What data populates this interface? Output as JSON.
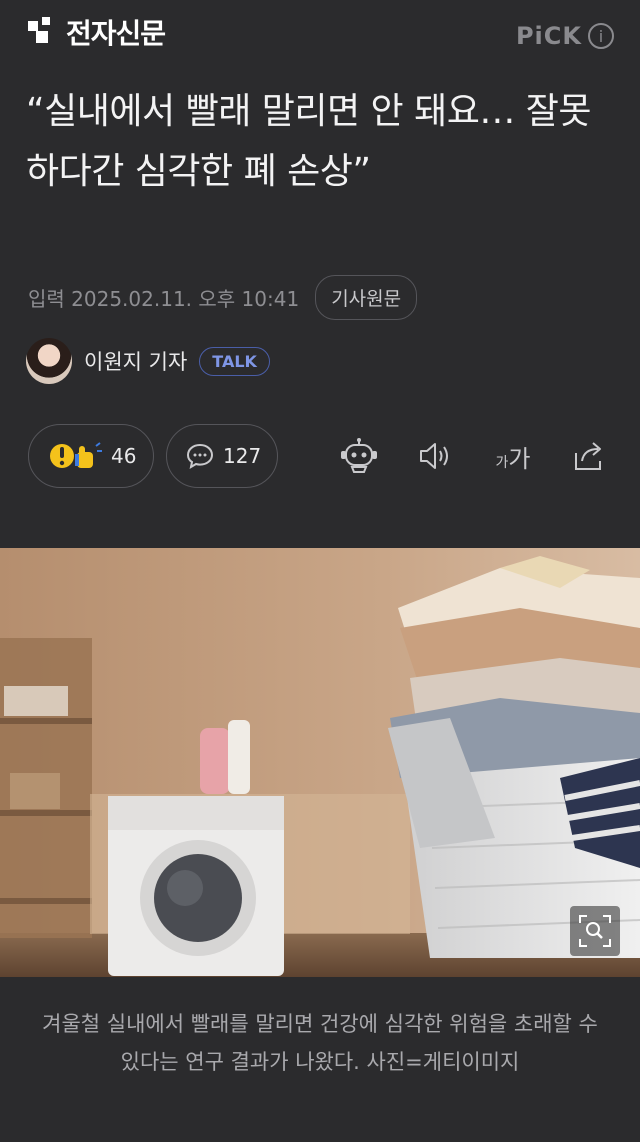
{
  "header": {
    "logo_text": "전자신문",
    "pick_text": "PiCK",
    "info_icon": "ⓘ"
  },
  "article": {
    "title": "“실내에서 빨래 말리면 안 돼요… 잘못하다간 심각한 폐 손상”",
    "date": "입력 2025.02.11. 오후 10:41",
    "original_button": "기사원문",
    "author": "이원지 기자",
    "talk_badge": "TALK"
  },
  "actions": {
    "reaction_count": "46",
    "comment_count": "127",
    "font_size_label": "가가"
  },
  "image": {
    "caption": "겨울철 실내에서 빨래를 말리면 건강에 심각한 위험을 초래할 수 있다는 연구 결과가 나왔다. 사진=게티이미지"
  }
}
